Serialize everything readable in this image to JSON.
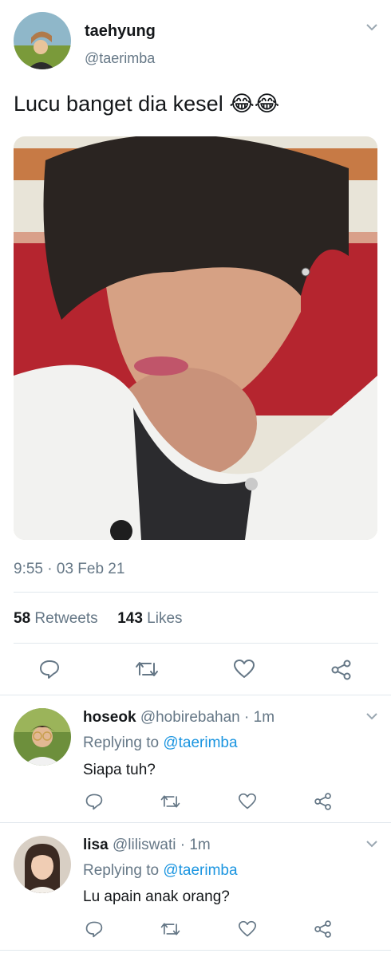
{
  "tweet": {
    "display_name": "taehyung",
    "handle": "@taerimba",
    "text": "Lucu banget dia kesel 😂😂",
    "time": "9:55",
    "date": "03 Feb 21",
    "retweet_count": "58",
    "retweet_label": "Retweets",
    "like_count": "143",
    "like_label": "Likes"
  },
  "replies": [
    {
      "display_name": "hoseok",
      "handle": "@hobirebahan",
      "age": "1m",
      "replying_prefix": "Replying to",
      "replying_to": "@taerimba",
      "text": "Siapa tuh?"
    },
    {
      "display_name": "lisa",
      "handle": "@liliswati",
      "age": "1m",
      "replying_prefix": "Replying to",
      "replying_to": "@taerimba",
      "text": "Lu apain anak orang?"
    }
  ],
  "colors": {
    "text": "#14171a",
    "muted": "#657786",
    "link": "#1b95e0",
    "divider": "#e1e8ed"
  }
}
